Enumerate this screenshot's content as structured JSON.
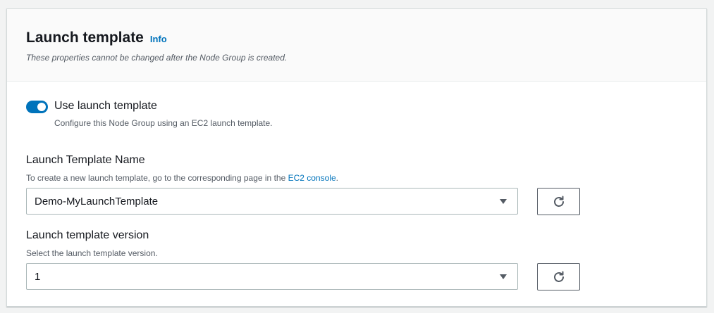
{
  "header": {
    "title": "Launch template",
    "info_link": "Info",
    "subtitle": "These properties cannot be changed after the Node Group is created."
  },
  "toggle": {
    "label": "Use launch template",
    "description": "Configure this Node Group using an EC2 launch template.",
    "checked": true
  },
  "template_name": {
    "label": "Launch Template Name",
    "description_prefix": "To create a new launch template, go to the corresponding page in the ",
    "description_link": "EC2 console",
    "description_suffix": ".",
    "value": "Demo-MyLaunchTemplate"
  },
  "template_version": {
    "label": "Launch template version",
    "description": "Select the launch template version.",
    "value": "1"
  },
  "icons": {
    "toggle": "toggle-switch-icon",
    "dropdown": "caret-down-icon",
    "refresh": "refresh-icon"
  },
  "colors": {
    "accent": "#0073bb",
    "text": "#16191f",
    "secondary_text": "#545b64",
    "header_bg": "#fafafa"
  }
}
